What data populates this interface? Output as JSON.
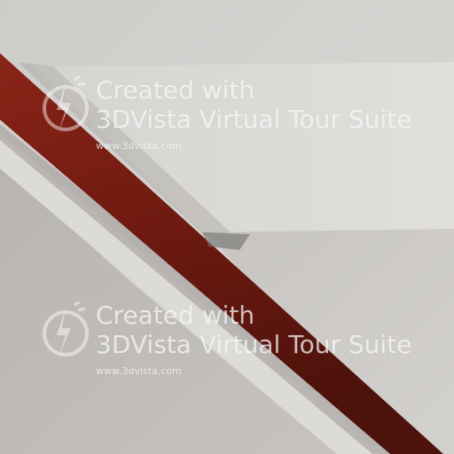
{
  "watermarks": [
    {
      "line1": "Created with",
      "line2": "3DVista Virtual Tour Suite",
      "url": "www.3dvista.com",
      "logo_icon": "3dvista-logo-icon"
    },
    {
      "line1": "Created with",
      "line2": "3DVista Virtual Tour Suite",
      "url": "www.3dvista.com",
      "logo_icon": "3dvista-logo-icon"
    }
  ],
  "colors": {
    "ceiling": "#d8d6d3",
    "wall_upper": "#cfccc8",
    "wall_lower": "#c4c1bd",
    "beam": "#7a1c12",
    "beam_shadow": "#4a100b",
    "watermark": "#ffffff"
  }
}
